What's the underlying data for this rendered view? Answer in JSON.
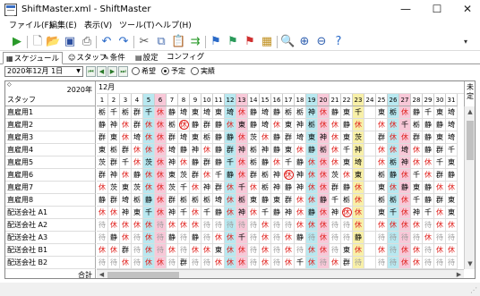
{
  "window": {
    "title": "ShiftMaster.xml - ShiftMaster",
    "min": "—",
    "max": "☐",
    "close": "✕"
  },
  "menu": [
    "ファイル(F)",
    "編集(E)",
    "表示(V)",
    "ツール(T)",
    "ヘルプ(H)"
  ],
  "toolbar_icons": [
    "run",
    "new",
    "open",
    "save",
    "print",
    "undo",
    "redo",
    "cut",
    "copy",
    "paste",
    "forward",
    "flag-blue",
    "flag-green",
    "flag-red",
    "grid-star",
    "zoom",
    "zoom-in",
    "zoom-out",
    "help"
  ],
  "tabs": [
    {
      "label": "スケジュール",
      "icon": "calendar-icon"
    },
    {
      "label": "スタッフ",
      "icon": "people-icon"
    },
    {
      "label": "条件",
      "icon": "condition-icon"
    },
    {
      "label": "設定",
      "icon": "settings-icon"
    },
    {
      "label": "コンフィグ",
      "icon": ""
    }
  ],
  "date": {
    "value": "2020年12月 1日",
    "radio": [
      {
        "label": "希望",
        "checked": false
      },
      {
        "label": "予定",
        "checked": true
      },
      {
        "label": "実績",
        "checked": false
      }
    ]
  },
  "grid": {
    "year": "2020年",
    "month": "12月",
    "staff_header": "スタッフ",
    "corner_mark": "◇",
    "unset_label": "未定",
    "total_label": "合計",
    "days": [
      "1",
      "2",
      "3",
      "4",
      "5",
      "6",
      "7",
      "8",
      "9",
      "10",
      "11",
      "12",
      "13",
      "14",
      "15",
      "16",
      "17",
      "18",
      "19",
      "20",
      "21",
      "22",
      "23",
      "24",
      "25",
      "26",
      "27",
      "28",
      "29",
      "30",
      "31"
    ],
    "day_colors": [
      "",
      "",
      "",
      "",
      "#b8e8f0",
      "#f8c8d8",
      "",
      "",
      "",
      "",
      "",
      "#b8e8f0",
      "#f8c8d8",
      "",
      "",
      "",
      "",
      "",
      "#b8e8f0",
      "#f8c8d8",
      "",
      "",
      "#f8f0a8",
      "",
      "",
      "#b8e8f0",
      "#f8c8d8",
      "",
      "",
      "",
      ""
    ],
    "rows": [
      {
        "name": "直雇用1",
        "cells": [
          "栃",
          "千",
          "栃",
          "群",
          "千",
          "休",
          "静",
          "埼",
          "東",
          "埼",
          "東",
          "埼",
          "休",
          "静",
          "埼",
          "静",
          "栃",
          "栃",
          "神",
          "休",
          "静",
          "東",
          "千",
          "",
          "東",
          "栃",
          "休",
          "静",
          "千",
          "東",
          "埼"
        ]
      },
      {
        "name": "直雇用2",
        "cells": [
          "静",
          "神",
          "休",
          "群",
          "休",
          "休",
          "栃",
          "(休)",
          "静",
          "群",
          "静",
          "休",
          "東",
          "静",
          "埼",
          "休",
          "東",
          "神",
          "栃",
          "休",
          "休",
          "静",
          "休",
          "",
          "休",
          "休",
          "千",
          "栃",
          "静",
          "静",
          "埼"
        ]
      },
      {
        "name": "直雇用3",
        "cells": [
          "群",
          "東",
          "休",
          "埼",
          "休",
          "休",
          "群",
          "埼",
          "東",
          "栃",
          "静",
          "静",
          "休",
          "茨",
          "休",
          "静",
          "群",
          "埼",
          "東",
          "神",
          "休",
          "東",
          "茨",
          "",
          "群",
          "休",
          "休",
          "群",
          "静",
          "東",
          "埼"
        ]
      },
      {
        "name": "直雇用4",
        "cells": [
          "東",
          "栃",
          "群",
          "休",
          "休",
          "休",
          "埼",
          "静",
          "神",
          "休",
          "静",
          "群",
          "神",
          "栃",
          "神",
          "静",
          "東",
          "休",
          "静",
          "栃",
          "休",
          "千",
          "神",
          "",
          "休",
          "休",
          "埼",
          "休",
          "静",
          "群",
          "千"
        ]
      },
      {
        "name": "直雇用5",
        "cells": [
          "茨",
          "群",
          "千",
          "休",
          "茨",
          "休",
          "神",
          "休",
          "静",
          "群",
          "静",
          "千",
          "休",
          "栃",
          "静",
          "休",
          "千",
          "静",
          "休",
          "休",
          "休",
          "東",
          "埼",
          "",
          "休",
          "栃",
          "神",
          "休",
          "休",
          "千",
          "東"
        ]
      },
      {
        "name": "直雇用6",
        "cells": [
          "群",
          "神",
          "休",
          "静",
          "休",
          "休",
          "東",
          "茨",
          "群",
          "休",
          "千",
          "静",
          "休",
          "群",
          "栃",
          "神",
          "(休)",
          "神",
          "休",
          "休",
          "茨",
          "休",
          "東",
          "",
          "栃",
          "静",
          "休",
          "千",
          "休",
          "群",
          "静"
        ]
      },
      {
        "name": "直雇用7",
        "cells": [
          "休",
          "茨",
          "東",
          "茨",
          "休",
          "休",
          "茨",
          "千",
          "休",
          "神",
          "群",
          "休",
          "千",
          "休",
          "栃",
          "神",
          "静",
          "神",
          "休",
          "休",
          "群",
          "静",
          "休",
          "",
          "東",
          "休",
          "静",
          "東",
          "静",
          "休",
          "休"
        ]
      },
      {
        "name": "直雇用8",
        "cells": [
          "静",
          "群",
          "埼",
          "栃",
          "静",
          "休",
          "群",
          "栃",
          "栃",
          "栃",
          "埼",
          "休",
          "栃",
          "東",
          "静",
          "東",
          "群",
          "休",
          "休",
          "静",
          "千",
          "栃",
          "休",
          "",
          "栃",
          "栃",
          "休",
          "千",
          "静",
          "群",
          "東"
        ]
      },
      {
        "name": "配送会社 A1",
        "cells": [
          "休",
          "休",
          "神",
          "東",
          "千",
          "休",
          "神",
          "千",
          "休",
          "千",
          "静",
          "休",
          "神",
          "休",
          "千",
          "静",
          "神",
          "休",
          "静",
          "休",
          "神",
          "(休)",
          "休",
          "",
          "東",
          "千",
          "休",
          "神",
          "千",
          "休",
          "東"
        ]
      },
      {
        "name": "配送会社 A2",
        "cells": [
          "待",
          "休",
          "休",
          "休",
          "休",
          "待",
          "休",
          "休",
          "休",
          "待",
          "待",
          "待",
          "待",
          "待",
          "休",
          "待",
          "待",
          "休",
          "休",
          "休",
          "待",
          "待",
          "休",
          "",
          "休",
          "休",
          "休",
          "休",
          "待",
          "休",
          "休"
        ]
      },
      {
        "name": "配送会社 A3",
        "cells": [
          "待",
          "静",
          "休",
          "待",
          "休",
          "待",
          "静",
          "待",
          "静",
          "待",
          "休",
          "休",
          "千",
          "待",
          "休",
          "待",
          "休",
          "静",
          "待",
          "休",
          "待",
          "待",
          "静",
          "",
          "待",
          "待",
          "待",
          "待",
          "休",
          "待",
          "待"
        ]
      },
      {
        "name": "配送会社 B1",
        "cells": [
          "休",
          "休",
          "群",
          "待",
          "休",
          "待",
          "休",
          "待",
          "休",
          "休",
          "東",
          "休",
          "休",
          "待",
          "休",
          "待",
          "休",
          "待",
          "休",
          "休",
          "待",
          "東",
          "休",
          "",
          "休",
          "待",
          "休",
          "休",
          "待",
          "休",
          "休"
        ]
      },
      {
        "name": "配送会社 B2",
        "cells": [
          "待",
          "待",
          "休",
          "待",
          "休",
          "休",
          "待",
          "群",
          "待",
          "待",
          "休",
          "休",
          "休",
          "待",
          "休",
          "待",
          "休",
          "千",
          "休",
          "待",
          "休",
          "群",
          "待",
          "",
          "待",
          "待",
          "休",
          "休",
          "待",
          "待",
          "待"
        ]
      }
    ]
  }
}
